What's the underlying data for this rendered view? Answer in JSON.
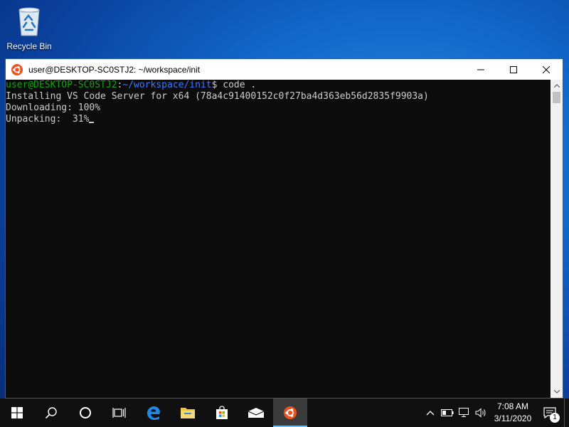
{
  "desktop": {
    "recycle_bin_label": "Recycle Bin"
  },
  "window": {
    "title": "user@DESKTOP-SC0STJ2: ~/workspace/init",
    "terminal": {
      "prompt_user": "user@DESKTOP-SC0STJ2",
      "prompt_sep": ":",
      "prompt_path": "~/workspace/init",
      "prompt_end": "$ ",
      "command": "code .",
      "line2": "Installing VS Code Server for x64 (78a4c91400152c0f27ba4d363eb56d2835f9903a)",
      "line3": "Downloading: 100%",
      "line4": "Unpacking:  31%"
    }
  },
  "taskbar": {
    "clock_time": "7:08 AM",
    "clock_date": "3/11/2020",
    "notification_count": "1"
  },
  "colors": {
    "prompt_user": "#13a10e",
    "prompt_path": "#3b78ff",
    "ubuntu_orange": "#e95420",
    "taskbar_accent": "#76b9ed"
  }
}
